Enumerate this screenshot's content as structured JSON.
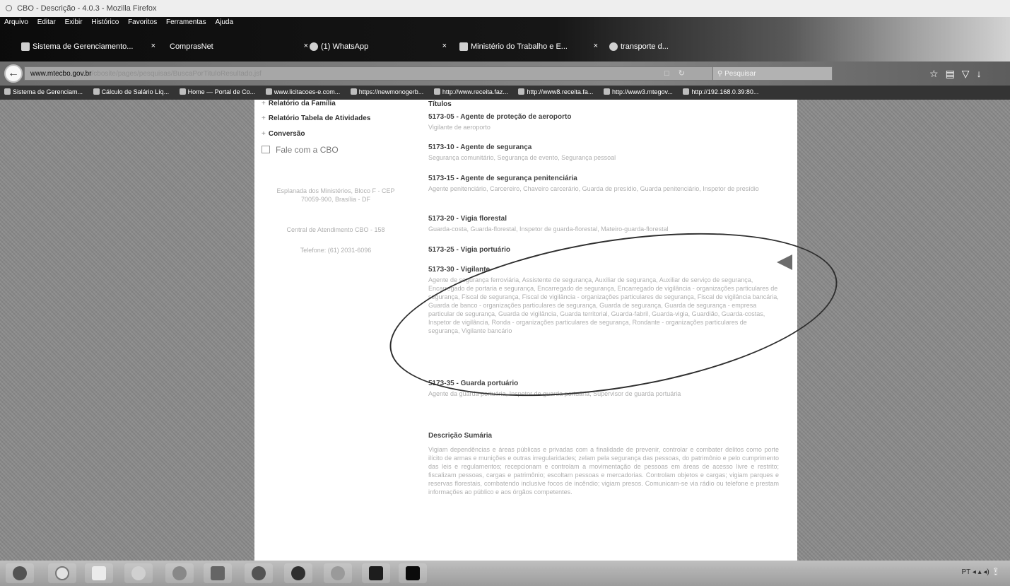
{
  "window_title": "CBO - Descrição - 4.0.3 - Mozilla Firefox",
  "menu": [
    "Arquivo",
    "Editar",
    "Exibir",
    "Histórico",
    "Favoritos",
    "Ferramentas",
    "Ajuda"
  ],
  "tabs": [
    {
      "label": "Sistema de Gerenciamento...",
      "close": "×"
    },
    {
      "label": "ComprasNet",
      "close": "×"
    },
    {
      "label": "(1) WhatsApp",
      "close": "×"
    },
    {
      "label": "Ministério do Trabalho e E...",
      "close": "×"
    },
    {
      "label": "transporte d...",
      "close": ""
    }
  ],
  "url": {
    "host": "www.mtecbo.gov.br",
    "path": "/cbosite/pages/pesquisas/BuscaPorTituloResultado.jsf"
  },
  "search_placeholder": "Pesquisar",
  "bookmarks": [
    "Sistema de Gerenciam...",
    "Cálculo de Salário Líq...",
    "Home — Portal de Co...",
    "www.licitacoes-e.com...",
    "https://newmonogerb...",
    "http://www.receita.faz...",
    "http://www8.receita.fa...",
    "http://www3.mtegov...",
    "http://192.168.0.39:80..."
  ],
  "sidebar": {
    "links": [
      "Relatório da Família",
      "Relatório Tabela de Atividades",
      "Conversão"
    ],
    "fale": "Fale com a CBO",
    "address": "Esplanada dos Ministérios, Bloco F - CEP 70059-900, Brasília - DF",
    "central": "Central de Atendimento CBO - 158",
    "phone": "Telefone: (61) 2031-6096"
  },
  "main": {
    "heading": "Títulos",
    "titles": [
      {
        "title": "5173-05 - Agente de proteção de aeroporto",
        "desc": "Vigilante de aeroporto"
      },
      {
        "title": "5173-10 - Agente de segurança",
        "desc": "Segurança comunitário, Segurança de evento, Segurança pessoal"
      },
      {
        "title": "5173-15 - Agente de segurança penitenciária",
        "desc": "Agente penitenciário, Carcereiro, Chaveiro carcerário, Guarda de presídio, Guarda penitenciário, Inspetor de presídio"
      },
      {
        "title": "5173-20 - Vigia florestal",
        "desc": "Guarda-costa, Guarda-florestal, Inspetor de guarda-florestal, Mateiro-guarda-florestal"
      },
      {
        "title": "5173-25 - Vigia portuário",
        "desc": ""
      },
      {
        "title": "5173-30 - Vigilante",
        "desc": "Agente de segurança ferroviária, Assistente de segurança, Auxiliar de segurança, Auxiliar de serviço de segurança, Encarregado de portaria e segurança, Encarregado de segurança, Encarregado de vigilância - organizações particulares de segurança, Fiscal de segurança, Fiscal de vigilância - organizações particulares de segurança, Fiscal de vigilância bancária, Guarda de banco - organizações particulares de segurança, Guarda de segurança, Guarda de segurança - empresa particular de segurança, Guarda de vigilância, Guarda territorial, Guarda-fabril, Guarda-vigia, Guardião, Guarda-costas, Inspetor de vigilância, Ronda - organizações particulares de segurança, Rondante - organizações particulares de segurança, Vigilante bancário"
      },
      {
        "title": "5173-35 - Guarda portuário",
        "desc": "Agente da guarda portuária, Inspetor de guarda portuária, Supervisor de guarda portuária"
      }
    ],
    "desc_heading": "Descrição Sumária",
    "desc_body": "Vigiam dependências e áreas públicas e privadas com a finalidade de prevenir, controlar e combater delitos como porte ilícito de armas e munições e outras irregularidades; zelam pela segurança das pessoas, do patrimônio e pelo cumprimento das leis e regulamentos; recepcionam e controlam a movimentação de pessoas em áreas de acesso livre e restrito; fiscalizam pessoas, cargas e patrimônio; escoltam pessoas e mercadorias. Controlam objetos e cargas; vigiam parques e reservas florestais, combatendo inclusive focos de incêndio; vigiam presos. Comunicam-se via rádio ou telefone e prestam informações ao público e aos órgãos competentes."
  },
  "tray": "PT  ◂  ▴  ◂)  🔋"
}
